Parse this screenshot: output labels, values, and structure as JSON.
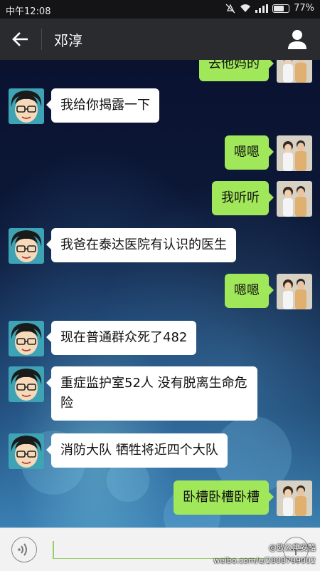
{
  "status_bar": {
    "time": "中午12:08",
    "battery": "77%",
    "battery_level": 0.77
  },
  "header": {
    "title": "邓淳"
  },
  "messages": [
    {
      "side": "right",
      "text": "去他妈的"
    },
    {
      "side": "left",
      "text": "我给你揭露一下"
    },
    {
      "side": "right",
      "text": "嗯嗯"
    },
    {
      "side": "right",
      "text": "我听听"
    },
    {
      "side": "left",
      "text": "我爸在泰达医院有认识的医生"
    },
    {
      "side": "right",
      "text": "嗯嗯"
    },
    {
      "side": "left",
      "text": "现在普通群众死了482"
    },
    {
      "side": "left",
      "text": "重症监护室52人 没有脱离生命危险"
    },
    {
      "side": "left",
      "text": "消防大队 牺牲将近四个大队"
    },
    {
      "side": "right",
      "text": "卧槽卧槽卧槽"
    }
  ],
  "input": {
    "value": ""
  },
  "watermark": {
    "handle": "@欧公寓安酷",
    "url": "weibo.com/u/2808709002"
  },
  "colors": {
    "header_bg": "#2a2b2f",
    "bubble_right": "#a0e75a",
    "bubble_left": "#ffffff",
    "input_accent": "#9acd6a"
  }
}
